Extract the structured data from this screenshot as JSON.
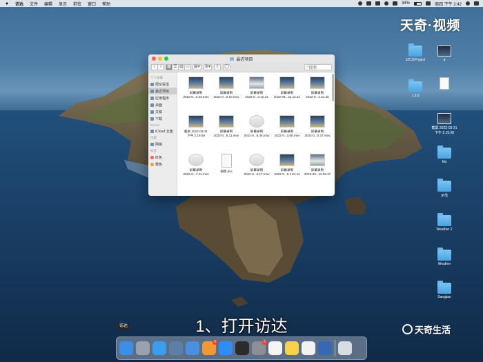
{
  "menubar": {
    "app": "访达",
    "items": [
      "文件",
      "编辑",
      "显示",
      "前往",
      "窗口",
      "帮助"
    ],
    "battery": "34%",
    "clock": "周四 下午 2:42"
  },
  "watermark": "天奇·视频",
  "desktop_icons": [
    {
      "label": "JZCGProject",
      "kind": "folder"
    },
    {
      "label": "a",
      "kind": "thumb"
    },
    {
      "label": "1.2.3",
      "kind": "folder"
    },
    {
      "label": "",
      "kind": "doc"
    },
    {
      "label": "截屏 2022-03-31 下午 2.19.08",
      "kind": "thumb"
    },
    {
      "label": "fds",
      "kind": "folder"
    },
    {
      "label": "示范",
      "kind": "folder"
    },
    {
      "label": "Weather 2",
      "kind": "folder"
    },
    {
      "label": "Weather",
      "kind": "folder"
    },
    {
      "label": "Sangjian",
      "kind": "folder"
    }
  ],
  "finder": {
    "title": "最近项目",
    "search_placeholder": "搜索",
    "sidebar": {
      "sections": [
        {
          "header": "个人收藏",
          "items": [
            "隔空投送",
            "最近项目",
            "应用程序",
            "桌面",
            "文稿",
            "下载"
          ]
        },
        {
          "header": "iCloud",
          "items": [
            "iCloud 云盘"
          ]
        },
        {
          "header": "位置",
          "items": [
            "网络"
          ]
        },
        {
          "header": "标签",
          "items": [
            "红色",
            "橙色"
          ]
        }
      ]
    },
    "files": [
      {
        "name": "屏幕录制",
        "sub": "2022-0...3.53.mov",
        "style": "dark"
      },
      {
        "name": "屏幕录制",
        "sub": "2022-0...0.10.mov",
        "style": "dark"
      },
      {
        "name": "屏幕录制",
        "sub": "2022-0...3.12.41",
        "style": "mixed"
      },
      {
        "name": "屏幕录制",
        "sub": "2022-04...11.12.21",
        "style": "dark"
      },
      {
        "name": "屏幕录制",
        "sub": "2022-0...2.21.30",
        "style": "dark"
      },
      {
        "name": "截屏 2022-03-31",
        "sub": "下午 2.19.08",
        "style": "dark"
      },
      {
        "name": "屏幕录制",
        "sub": "2022-0...8.11.mov",
        "style": "dark"
      },
      {
        "name": "屏幕录制",
        "sub": "2022-0...8.46.mov",
        "style": "light"
      },
      {
        "name": "屏幕录制",
        "sub": "2022-0...3.06.mov",
        "style": "dark"
      },
      {
        "name": "屏幕录制",
        "sub": "2022-0...0.37.mov",
        "style": "dark"
      },
      {
        "name": "屏幕录制",
        "sub": "2022-0...7.21.mov",
        "style": "light"
      },
      {
        "name": "视频.doc",
        "sub": "",
        "style": "doc"
      },
      {
        "name": "屏幕录制",
        "sub": "2022-0...3.17.mov",
        "style": "light"
      },
      {
        "name": "屏幕录制",
        "sub": "2022-0...9.1.51.11",
        "style": "dark"
      },
      {
        "name": "屏幕录制",
        "sub": "2022-03...11.33.17",
        "style": "mixed"
      }
    ]
  },
  "subtitle": "1、打开访达",
  "logo2": "天奇生活",
  "dock": {
    "tooltip": "访达",
    "apps": [
      {
        "name": "finder",
        "color": "#3d8ee8"
      },
      {
        "name": "launchpad",
        "color": "#9aa3ad"
      },
      {
        "name": "safari",
        "color": "#3a9df0"
      },
      {
        "name": "xcode",
        "color": "#5b7fa6"
      },
      {
        "name": "files",
        "color": "#4a90e2"
      },
      {
        "name": "pages",
        "color": "#f19a33",
        "badge": "6"
      },
      {
        "name": "app-store",
        "color": "#2f8ef5"
      },
      {
        "name": "terminal",
        "color": "#2b2b2b"
      },
      {
        "name": "system-preferences",
        "color": "#8e8e93",
        "badge": "2"
      },
      {
        "name": "qq",
        "color": "#f5f5f5"
      },
      {
        "name": "notes",
        "color": "#f7d24a"
      },
      {
        "name": "qq-2",
        "color": "#f2f2f2"
      },
      {
        "name": "quicktime",
        "color": "#3668b3"
      },
      {
        "name": "trash",
        "color": "#d9dde2"
      }
    ]
  }
}
